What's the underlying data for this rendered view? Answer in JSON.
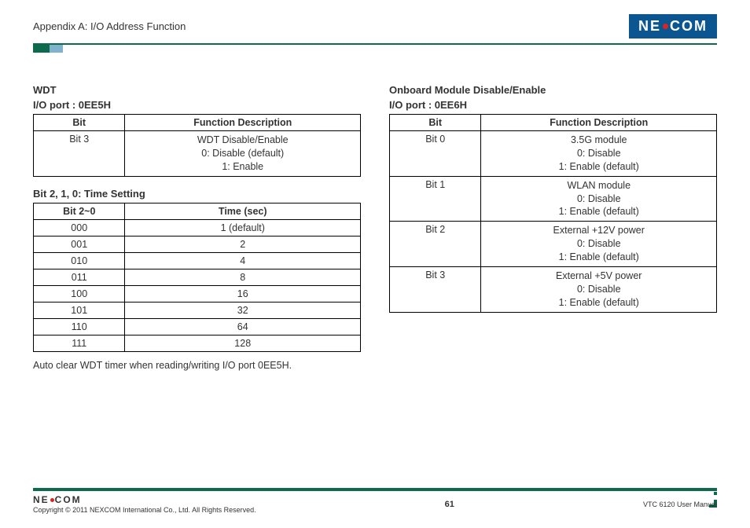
{
  "header": {
    "appendix": "Appendix A: I/O Address Function",
    "logo_left": "NE",
    "logo_right": "COM"
  },
  "left": {
    "title1": "WDT",
    "title2": "I/O port : 0EE5H",
    "table1": {
      "col1": "Bit",
      "col2": "Function Description",
      "row_bit": "Bit 3",
      "row_desc_l1": "WDT Disable/Enable",
      "row_desc_l2": "0: Disable (default)",
      "row_desc_l3": "1: Enable"
    },
    "sub": "Bit 2, 1, 0: Time Setting",
    "table2": {
      "col1": "Bit 2~0",
      "col2": "Time (sec)",
      "rows": [
        {
          "b": "000",
          "t": "1 (default)"
        },
        {
          "b": "001",
          "t": "2"
        },
        {
          "b": "010",
          "t": "4"
        },
        {
          "b": "011",
          "t": "8"
        },
        {
          "b": "100",
          "t": "16"
        },
        {
          "b": "101",
          "t": "32"
        },
        {
          "b": "110",
          "t": "64"
        },
        {
          "b": "111",
          "t": "128"
        }
      ]
    },
    "note": "Auto clear WDT timer when reading/writing I/O port 0EE5H."
  },
  "right": {
    "title1": "Onboard Module Disable/Enable",
    "title2": "I/O port : 0EE6H",
    "table": {
      "col1": "Bit",
      "col2": "Function Description",
      "rows": [
        {
          "b": "Bit 0",
          "l1": "3.5G module",
          "l2": "0: Disable",
          "l3": "1: Enable (default)"
        },
        {
          "b": "Bit 1",
          "l1": "WLAN module",
          "l2": "0: Disable",
          "l3": "1: Enable (default)"
        },
        {
          "b": "Bit 2",
          "l1": "External +12V power",
          "l2": "0: Disable",
          "l3": "1: Enable (default)"
        },
        {
          "b": "Bit 3",
          "l1": "External +5V power",
          "l2": "0: Disable",
          "l3": "1: Enable (default)"
        }
      ]
    }
  },
  "footer": {
    "logo_left": "NE",
    "logo_right": "COM",
    "copyright": "Copyright © 2011 NEXCOM International Co., Ltd. All Rights Reserved.",
    "page": "61",
    "manual": "VTC 6120 User Manual"
  }
}
